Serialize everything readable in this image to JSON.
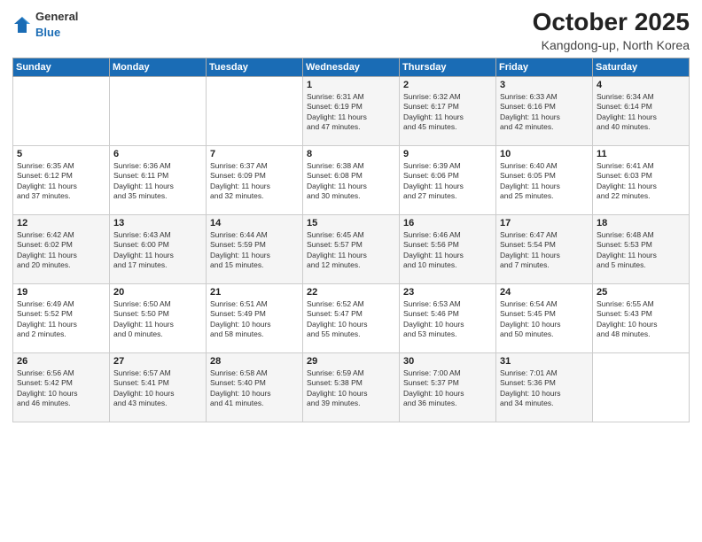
{
  "logo": {
    "general": "General",
    "blue": "Blue"
  },
  "header": {
    "month": "October 2025",
    "location": "Kangdong-up, North Korea"
  },
  "weekdays": [
    "Sunday",
    "Monday",
    "Tuesday",
    "Wednesday",
    "Thursday",
    "Friday",
    "Saturday"
  ],
  "weeks": [
    [
      {
        "day": "",
        "text": ""
      },
      {
        "day": "",
        "text": ""
      },
      {
        "day": "",
        "text": ""
      },
      {
        "day": "1",
        "text": "Sunrise: 6:31 AM\nSunset: 6:19 PM\nDaylight: 11 hours\nand 47 minutes."
      },
      {
        "day": "2",
        "text": "Sunrise: 6:32 AM\nSunset: 6:17 PM\nDaylight: 11 hours\nand 45 minutes."
      },
      {
        "day": "3",
        "text": "Sunrise: 6:33 AM\nSunset: 6:16 PM\nDaylight: 11 hours\nand 42 minutes."
      },
      {
        "day": "4",
        "text": "Sunrise: 6:34 AM\nSunset: 6:14 PM\nDaylight: 11 hours\nand 40 minutes."
      }
    ],
    [
      {
        "day": "5",
        "text": "Sunrise: 6:35 AM\nSunset: 6:12 PM\nDaylight: 11 hours\nand 37 minutes."
      },
      {
        "day": "6",
        "text": "Sunrise: 6:36 AM\nSunset: 6:11 PM\nDaylight: 11 hours\nand 35 minutes."
      },
      {
        "day": "7",
        "text": "Sunrise: 6:37 AM\nSunset: 6:09 PM\nDaylight: 11 hours\nand 32 minutes."
      },
      {
        "day": "8",
        "text": "Sunrise: 6:38 AM\nSunset: 6:08 PM\nDaylight: 11 hours\nand 30 minutes."
      },
      {
        "day": "9",
        "text": "Sunrise: 6:39 AM\nSunset: 6:06 PM\nDaylight: 11 hours\nand 27 minutes."
      },
      {
        "day": "10",
        "text": "Sunrise: 6:40 AM\nSunset: 6:05 PM\nDaylight: 11 hours\nand 25 minutes."
      },
      {
        "day": "11",
        "text": "Sunrise: 6:41 AM\nSunset: 6:03 PM\nDaylight: 11 hours\nand 22 minutes."
      }
    ],
    [
      {
        "day": "12",
        "text": "Sunrise: 6:42 AM\nSunset: 6:02 PM\nDaylight: 11 hours\nand 20 minutes."
      },
      {
        "day": "13",
        "text": "Sunrise: 6:43 AM\nSunset: 6:00 PM\nDaylight: 11 hours\nand 17 minutes."
      },
      {
        "day": "14",
        "text": "Sunrise: 6:44 AM\nSunset: 5:59 PM\nDaylight: 11 hours\nand 15 minutes."
      },
      {
        "day": "15",
        "text": "Sunrise: 6:45 AM\nSunset: 5:57 PM\nDaylight: 11 hours\nand 12 minutes."
      },
      {
        "day": "16",
        "text": "Sunrise: 6:46 AM\nSunset: 5:56 PM\nDaylight: 11 hours\nand 10 minutes."
      },
      {
        "day": "17",
        "text": "Sunrise: 6:47 AM\nSunset: 5:54 PM\nDaylight: 11 hours\nand 7 minutes."
      },
      {
        "day": "18",
        "text": "Sunrise: 6:48 AM\nSunset: 5:53 PM\nDaylight: 11 hours\nand 5 minutes."
      }
    ],
    [
      {
        "day": "19",
        "text": "Sunrise: 6:49 AM\nSunset: 5:52 PM\nDaylight: 11 hours\nand 2 minutes."
      },
      {
        "day": "20",
        "text": "Sunrise: 6:50 AM\nSunset: 5:50 PM\nDaylight: 11 hours\nand 0 minutes."
      },
      {
        "day": "21",
        "text": "Sunrise: 6:51 AM\nSunset: 5:49 PM\nDaylight: 10 hours\nand 58 minutes."
      },
      {
        "day": "22",
        "text": "Sunrise: 6:52 AM\nSunset: 5:47 PM\nDaylight: 10 hours\nand 55 minutes."
      },
      {
        "day": "23",
        "text": "Sunrise: 6:53 AM\nSunset: 5:46 PM\nDaylight: 10 hours\nand 53 minutes."
      },
      {
        "day": "24",
        "text": "Sunrise: 6:54 AM\nSunset: 5:45 PM\nDaylight: 10 hours\nand 50 minutes."
      },
      {
        "day": "25",
        "text": "Sunrise: 6:55 AM\nSunset: 5:43 PM\nDaylight: 10 hours\nand 48 minutes."
      }
    ],
    [
      {
        "day": "26",
        "text": "Sunrise: 6:56 AM\nSunset: 5:42 PM\nDaylight: 10 hours\nand 46 minutes."
      },
      {
        "day": "27",
        "text": "Sunrise: 6:57 AM\nSunset: 5:41 PM\nDaylight: 10 hours\nand 43 minutes."
      },
      {
        "day": "28",
        "text": "Sunrise: 6:58 AM\nSunset: 5:40 PM\nDaylight: 10 hours\nand 41 minutes."
      },
      {
        "day": "29",
        "text": "Sunrise: 6:59 AM\nSunset: 5:38 PM\nDaylight: 10 hours\nand 39 minutes."
      },
      {
        "day": "30",
        "text": "Sunrise: 7:00 AM\nSunset: 5:37 PM\nDaylight: 10 hours\nand 36 minutes."
      },
      {
        "day": "31",
        "text": "Sunrise: 7:01 AM\nSunset: 5:36 PM\nDaylight: 10 hours\nand 34 minutes."
      },
      {
        "day": "",
        "text": ""
      }
    ]
  ]
}
